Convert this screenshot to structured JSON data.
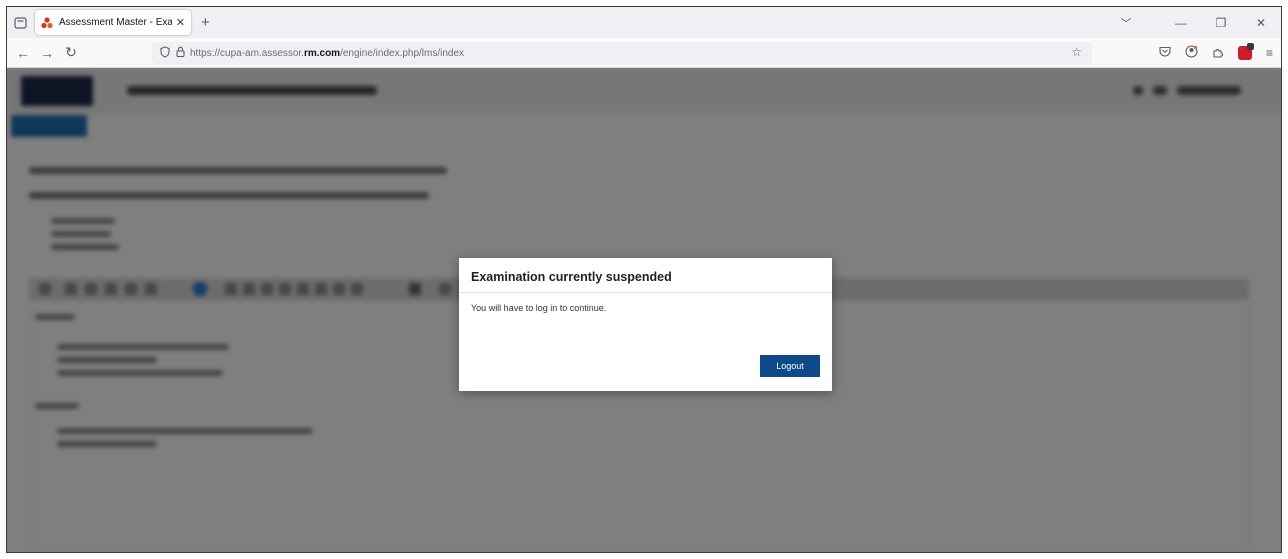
{
  "browser": {
    "tab": {
      "title": "Assessment Master - Exam Win",
      "close_icon": "close-icon",
      "favicon_color": "#d4351c"
    },
    "url": {
      "prefix": "https://cupa-am.assessor.",
      "domain": "rm.com",
      "path": "/engine/index.php/lms/index"
    }
  },
  "modal": {
    "title": "Examination currently suspended",
    "message": "You will have to log in to continue.",
    "logout_label": "Logout",
    "button_color": "#0d4a8b"
  },
  "colors": {
    "overlay": "rgba(0,0,0,0.5)",
    "accent_blue": "#1f6fb5"
  }
}
